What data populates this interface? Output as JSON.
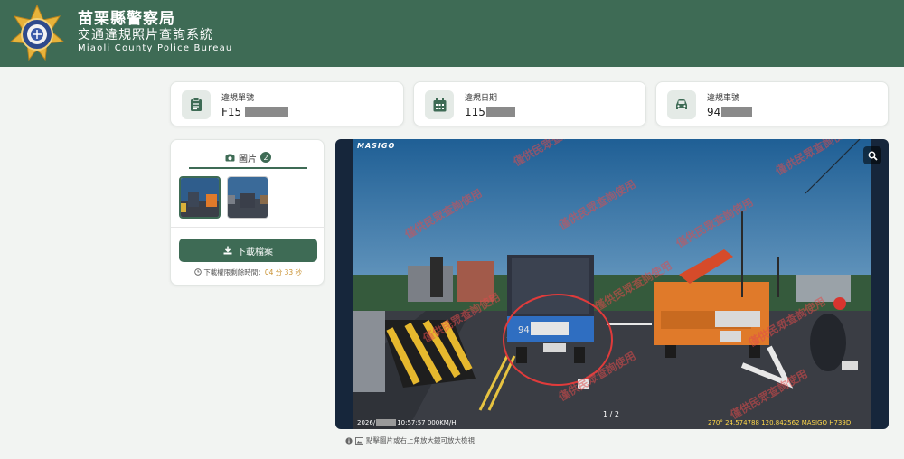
{
  "header": {
    "title": "苗栗縣警察局",
    "subtitle": "交通違規照片查詢系統",
    "english": "Miaoli County Police Bureau"
  },
  "info_cards": [
    {
      "label": "違規單號",
      "value": "F15",
      "icon": "clipboard-icon"
    },
    {
      "label": "違規日期",
      "value": "115",
      "icon": "calendar-icon"
    },
    {
      "label": "違規車號",
      "value": "94",
      "icon": "car-icon"
    }
  ],
  "photos": {
    "tab_label": "圖片",
    "count": "2",
    "download_label": "下載檔案",
    "timer_label": "下載權限剩餘時間：",
    "timer_value": "04 分 33 秒"
  },
  "viewer": {
    "brand": "MASIGO",
    "counter": "1 / 2",
    "stamp_left_prefix": "2026/",
    "stamp_left_suffix": "10:57:57 000KM/H",
    "stamp_right": "270°  24.574788   120.842562   MASIGO H739D",
    "plate_prefix": "94",
    "watermark": "僅供民眾查詢使用"
  },
  "hint": "點擊圖片或右上角放大鏡可放大檢視",
  "colors": {
    "primary": "#3e6b55",
    "accent": "#c8902f",
    "card_icon_bg": "#e4eae6"
  }
}
